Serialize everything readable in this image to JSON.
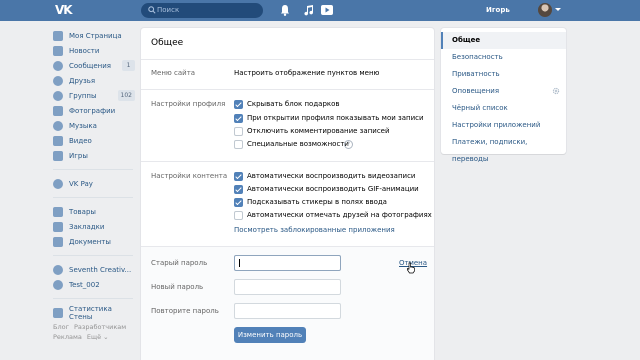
{
  "header": {
    "logo": "VK",
    "search_placeholder": "Поиск",
    "username": "Игорь"
  },
  "sidebar": {
    "items": [
      {
        "label": "Моя Страница",
        "icon": "home-icon",
        "color": "#5d7fa6"
      },
      {
        "label": "Новости",
        "icon": "news-icon",
        "color": "#5d7fa6"
      },
      {
        "label": "Сообщения",
        "icon": "messages-icon",
        "color": "#5d7fa6",
        "badge": "1"
      },
      {
        "label": "Друзья",
        "icon": "friends-icon",
        "color": "#5d7fa6"
      },
      {
        "label": "Группы",
        "icon": "groups-icon",
        "color": "#5d7fa6",
        "badge": "102"
      },
      {
        "label": "Фотографии",
        "icon": "photos-icon",
        "color": "#5d7fa6"
      },
      {
        "label": "Музыка",
        "icon": "music-icon",
        "color": "#5d7fa6"
      },
      {
        "label": "Видео",
        "icon": "video-icon",
        "color": "#5d7fa6"
      },
      {
        "label": "Игры",
        "icon": "games-icon",
        "color": "#5d7fa6"
      }
    ],
    "items2": [
      {
        "label": "VK Pay",
        "icon": "vkpay-icon",
        "color": "#5d7fa6"
      }
    ],
    "items3": [
      {
        "label": "Товары",
        "icon": "goods-icon",
        "color": "#5d7fa6"
      },
      {
        "label": "Закладки",
        "icon": "bookmarks-icon",
        "color": "#5d7fa6"
      },
      {
        "label": "Документы",
        "icon": "documents-icon",
        "color": "#5d7fa6"
      }
    ],
    "items4": [
      {
        "label": "Seventh Creativ...",
        "icon": "group-icon",
        "color": "#5d7fa6"
      },
      {
        "label": "Test_002",
        "icon": "group-icon",
        "color": "#5d7fa6"
      }
    ],
    "items5": [
      {
        "label": "Статистика Стены",
        "icon": "stats-icon",
        "color": "#5d7fa6"
      }
    ],
    "footer": [
      "Блог",
      "Разработчикам",
      "Реклама",
      "Ещё ⌄"
    ]
  },
  "main": {
    "title": "Общее",
    "site_menu_label": "Меню сайта",
    "site_menu_link": "Настроить отображение пунктов меню",
    "profile_label": "Настройки профиля",
    "profile_options": [
      {
        "label": "Скрывать блок подарков",
        "checked": true
      },
      {
        "label": "При открытии профиля показывать мои записи",
        "checked": true
      },
      {
        "label": "Отключить комментирование записей",
        "checked": false
      },
      {
        "label": "Специальные возможности",
        "checked": false
      }
    ],
    "content_label": "Настройки контента",
    "content_options": [
      {
        "label": "Автоматически воспроизводить видеозаписи",
        "checked": true
      },
      {
        "label": "Автоматически воспроизводить GIF-анимации",
        "checked": true
      },
      {
        "label": "Подсказывать стикеры в полях ввода",
        "checked": true
      },
      {
        "label": "Автоматически отмечать друзей на фотографиях",
        "checked": false
      }
    ],
    "blocked_apps_link": "Посмотреть заблокированные приложения",
    "old_password_label": "Старый пароль",
    "new_password_label": "Новый пароль",
    "repeat_password_label": "Повторите пароль",
    "cancel_link": "Отмена",
    "change_password_button": "Изменить пароль",
    "help_glyph": "?"
  },
  "right_menu": {
    "items": [
      {
        "label": "Общее",
        "active": true
      },
      {
        "label": "Безопасность",
        "active": false
      },
      {
        "label": "Приватность",
        "active": false
      },
      {
        "label": "Оповещения",
        "active": false
      },
      {
        "label": "Чёрный список",
        "active": false
      },
      {
        "label": "Настройки приложений",
        "active": false
      },
      {
        "label": "Платежи, подписки, переводы",
        "active": false
      }
    ]
  },
  "colors": {
    "header": "#4a76a8",
    "accent": "#5181b8",
    "link": "#2a5885",
    "background": "#edeef0"
  }
}
